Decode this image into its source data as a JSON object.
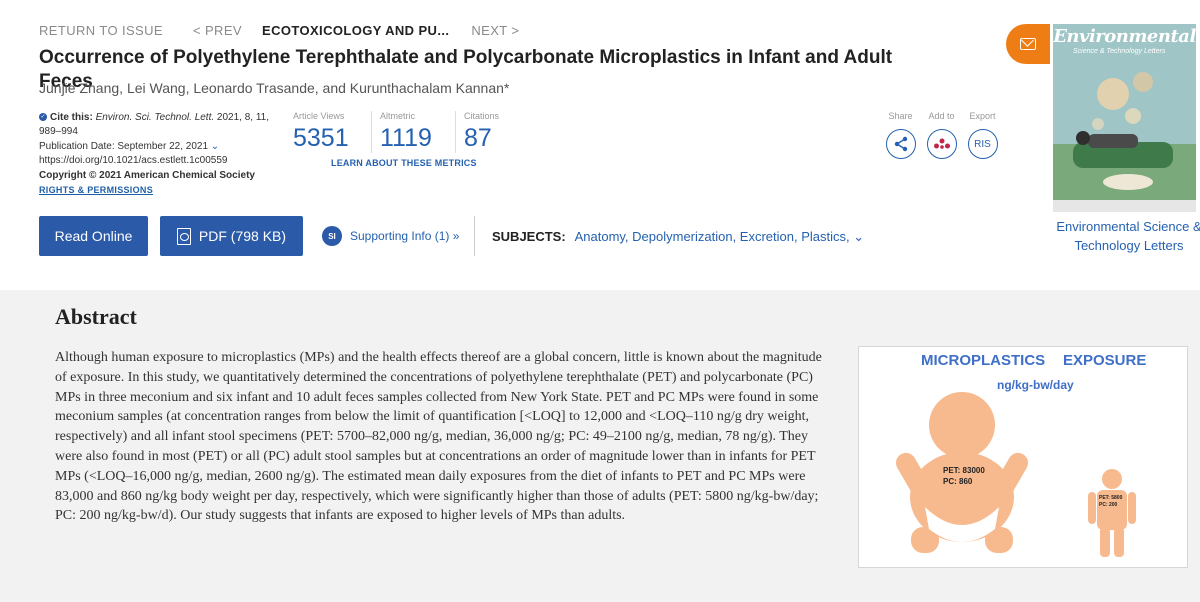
{
  "nav": {
    "return": "RETURN TO ISSUE",
    "prev": "< PREV",
    "current": "ECOTOXICOLOGY AND PU...",
    "next": "NEXT >"
  },
  "article": {
    "title": "Occurrence of Polyethylene Terephthalate and Polycarbonate Microplastics in Infant and Adult Feces",
    "authors": "Junjie Zhang, Lei Wang, Leonardo Trasande, and Kurunthachalam Kannan*"
  },
  "cite": {
    "label": "Cite this:",
    "journal": "Environ. Sci. Technol. Lett.",
    "ref": " 2021, 8, 11, 989–994",
    "pubdate": "Publication Date: September 22, 2021",
    "doi": "https://doi.org/10.1021/acs.estlett.1c00559",
    "copyright": "Copyright © 2021 American Chemical Society",
    "rights": "RIGHTS & PERMISSIONS"
  },
  "metrics": {
    "views_label": "Article Views",
    "views": "5351",
    "altmetric_label": "Altmetric",
    "altmetric": "1119",
    "citations_label": "Citations",
    "citations": "87",
    "learn": "LEARN ABOUT THESE METRICS"
  },
  "actions": {
    "share_label": "Share",
    "addto_label": "Add to",
    "export_label": "Export",
    "export_btn": "RIS"
  },
  "buttons": {
    "read": "Read Online",
    "pdf": "PDF (798 KB)",
    "si_badge": "SI",
    "si": "Supporting Info (1) »"
  },
  "subjects": {
    "label": "SUBJECTS:",
    "list": "Anatomy, Depolymerization, Excretion, Plastics,"
  },
  "journal": {
    "masthead": "Environmental",
    "masthead_sub": "Science & Technology Letters",
    "name": "Environmental Science & Technology Letters"
  },
  "abstract": {
    "heading": "Abstract",
    "text": "Although human exposure to microplastics (MPs) and the health effects thereof are a global concern, little is known about the magnitude of exposure. In this study, we quantitatively determined the concentrations of polyethylene terephthalate (PET) and polycarbonate (PC) MPs in three meconium and six infant and 10 adult feces samples collected from New York State. PET and PC MPs were found in some meconium samples (at concentration ranges from below the limit of quantification [<LOQ] to 12,000 and <LOQ–110 ng/g dry weight, respectively) and all infant stool specimens (PET: 5700–82,000 ng/g, median, 36,000 ng/g; PC: 49–2100 ng/g, median, 78 ng/g). They were also found in most (PET) or all (PC) adult stool samples but at concentrations an order of magnitude lower than in infants for PET MPs (<LOQ–16,000 ng/g, median, 2600 ng/g). The estimated mean daily exposures from the diet of infants to PET and PC MPs were 83,000 and 860 ng/kg body weight per day, respectively, which were significantly higher than those of adults (PET: 5800 ng/kg-bw/day; PC: 200 ng/kg-bw/d). Our study suggests that infants are exposed to higher levels of MPs than adults."
  },
  "toc_graphic": {
    "title_a": "MICROPLASTICS",
    "title_b": "EXPOSURE",
    "unit": "ng/kg-bw/day",
    "infant_pet": "PET: 83000",
    "infant_pc": "PC: 860",
    "adult_pet": "PET: 5800",
    "adult_pc": "PC: 200",
    "title_color": "#3f6fc6",
    "figure_color": "#f6ba8e"
  }
}
